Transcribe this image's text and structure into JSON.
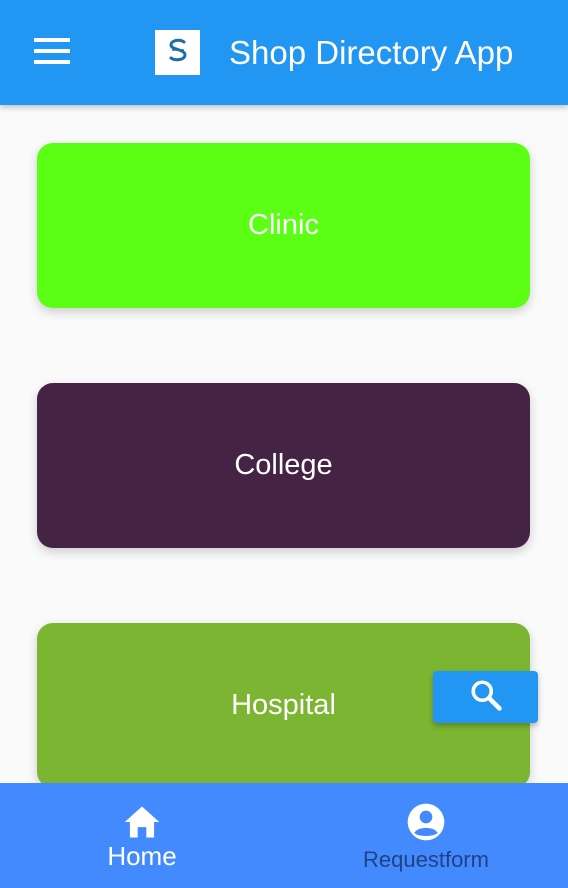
{
  "app_bar": {
    "title": "Shop Directory App",
    "menu_icon": "hamburger-menu-icon",
    "logo_icon": "app-logo-icon",
    "background_color": "#2196f3"
  },
  "categories": [
    {
      "label": "Clinic",
      "color": "#5aff14"
    },
    {
      "label": "College",
      "color": "#452345"
    },
    {
      "label": "Hospital",
      "color": "#7bb531"
    }
  ],
  "search_button": {
    "icon": "search-icon",
    "color": "#2196f3"
  },
  "bottom_nav": {
    "background_color": "#448aff",
    "items": [
      {
        "label": "Home",
        "icon": "home-icon",
        "selected": true
      },
      {
        "label": "Requestform",
        "icon": "account-circle-icon",
        "selected": false
      }
    ]
  }
}
